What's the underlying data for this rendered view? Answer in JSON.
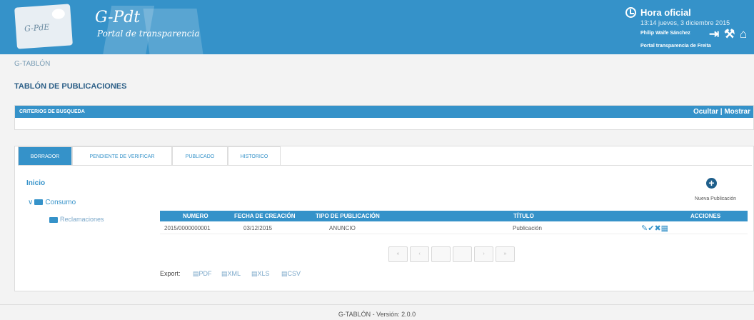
{
  "header": {
    "logo_text": "G-PdE",
    "brand": "G-Pdt",
    "brand_subtitle": "Portal de transparencia",
    "clock_title": "Hora oficial",
    "datetime": "13:14 jueves, 3 diciembre 2015",
    "user": "Philip Waife Sánchez",
    "portal": "Portal transparencia de Freita",
    "icons": [
      "logout-icon",
      "tools-icon",
      "building-icon"
    ]
  },
  "breadcrumb": "G-TABLÓN",
  "page_title": "TABLÓN DE PUBLICACIONES",
  "criteria": {
    "title": "CRITERIOS DE BUSQUEDA",
    "toggle": "Ocultar | Mostrar"
  },
  "tabs": [
    {
      "label": "BORRADOR",
      "active": true
    },
    {
      "label": "PENDIENTE DE VERIFICAR",
      "active": false
    },
    {
      "label": "PUBLICADO",
      "active": false
    },
    {
      "label": "HISTORICO",
      "active": false
    }
  ],
  "tree": {
    "root": "Inicio",
    "level1": "Consumo",
    "level2": "Reclamaciones"
  },
  "new_publication": "Nueva Publicación",
  "table": {
    "headers": [
      "NUMERO",
      "FECHA DE CREACIÓN",
      "TIPO DE PUBLICACIÓN",
      "TÍTULO",
      "ACCIONES"
    ],
    "rows": [
      {
        "numero": "2015/0000000001",
        "fecha": "03/12/2015",
        "tipo": "ANUNCIO",
        "titulo": "Publicación"
      }
    ]
  },
  "export": {
    "label": "Export:",
    "formats": [
      "PDF",
      "XML",
      "XLS",
      "CSV"
    ]
  },
  "footer": "G-TABLÓN - Versión: 2.0.0"
}
